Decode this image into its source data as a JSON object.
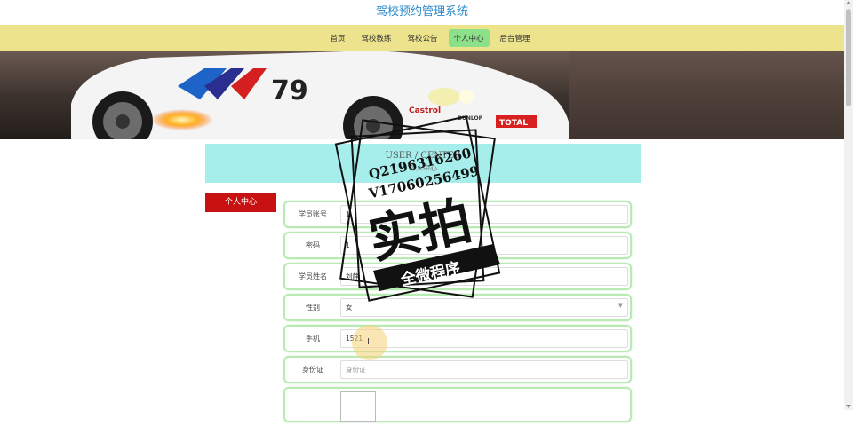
{
  "header": {
    "title": "驾校预约管理系统"
  },
  "nav": {
    "items": [
      {
        "label": "首页"
      },
      {
        "label": "驾校教练"
      },
      {
        "label": "驾校公告"
      },
      {
        "label": "个人中心"
      },
      {
        "label": "后台管理"
      }
    ],
    "active": "个人中心"
  },
  "banner": {
    "car_number": "79",
    "sponsor_1": "Castrol",
    "sponsor_2": "TOTAL",
    "sponsor_3": "DUNLOP"
  },
  "user_header": {
    "title": "USER / CENTER",
    "subtitle": "个人中心"
  },
  "side_menu": {
    "item": "个人中心"
  },
  "form": {
    "fields": [
      {
        "label": "学员账号",
        "value": "1"
      },
      {
        "label": "密码",
        "value": "1"
      },
      {
        "label": "学员姓名",
        "value": "刘静"
      },
      {
        "label": "性别",
        "value": "女"
      },
      {
        "label": "手机",
        "value": "1521"
      },
      {
        "label": "身份证",
        "placeholder": "身份证"
      },
      {
        "label": ""
      }
    ]
  },
  "watermark": {
    "line1": "Q2196316260",
    "line2": "V17060256499",
    "main": "实拍",
    "ribbon": "全微程序"
  },
  "colors": {
    "nav_bg": "#ece38c",
    "nav_active": "#8de08a",
    "title": "#2b89c9",
    "side_menu": "#c81212",
    "user_header_bg": "#a6eeec",
    "field_border": "#b7ebb2"
  }
}
